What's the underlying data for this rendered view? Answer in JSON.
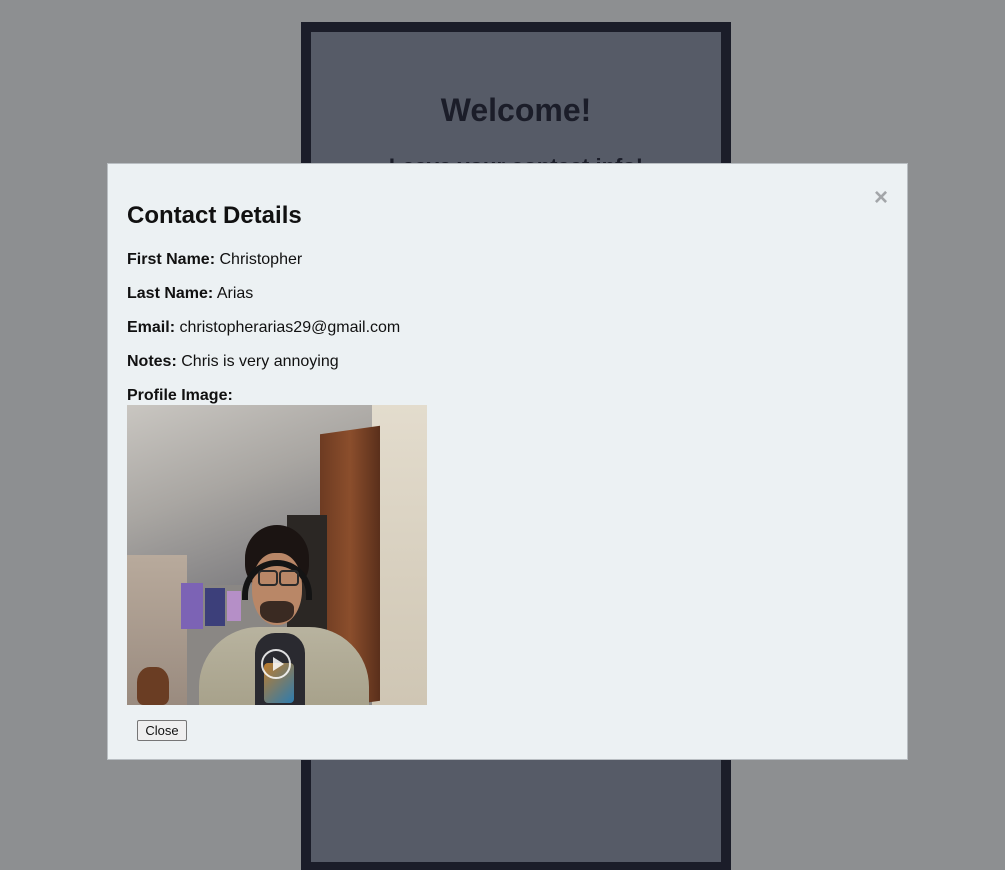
{
  "background_page": {
    "title": "Welcome!",
    "subtitle": "Leave your contact info!"
  },
  "modal": {
    "title": "Contact Details",
    "close_icon": "×",
    "fields": {
      "first_name": {
        "label": "First Name:",
        "value": "Christopher"
      },
      "last_name": {
        "label": "Last Name:",
        "value": "Arias"
      },
      "email": {
        "label": "Email:",
        "value": "christopherarias29@gmail.com"
      },
      "notes": {
        "label": "Notes:",
        "value": "Chris is very annoying"
      },
      "profile_image": {
        "label": "Profile Image:"
      }
    },
    "close_button_label": "Close"
  },
  "icons": {
    "close": "close-icon",
    "play": "play-icon"
  },
  "colors": {
    "page_overlay": "#8d8f91",
    "card_border": "#1b1d29",
    "card_fill": "#565b67",
    "modal_background": "#ecf1f3"
  }
}
